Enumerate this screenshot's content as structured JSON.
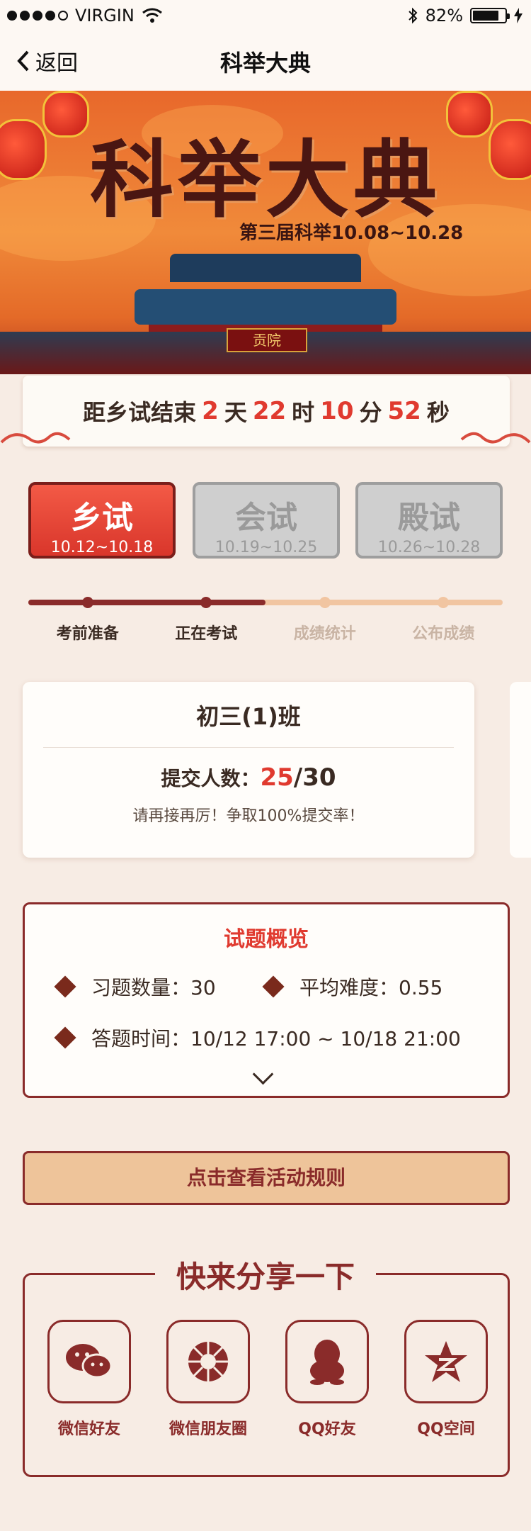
{
  "status_bar": {
    "carrier": "VIRGIN",
    "battery": "82%",
    "battery_level": 0.82
  },
  "nav": {
    "back_label": "返回",
    "title": "科举大典"
  },
  "banner": {
    "title": "科举大典",
    "subtitle": "第三届科举10.08~10.28",
    "plaque": "贡院"
  },
  "countdown": {
    "prefix": "距乡试结束",
    "days": "2",
    "days_unit": "天",
    "hours": "22",
    "hours_unit": "时",
    "minutes": "10",
    "minutes_unit": "分",
    "seconds": "52",
    "seconds_unit": "秒"
  },
  "stages": [
    {
      "name": "乡试",
      "dates": "10.12~10.18"
    },
    {
      "name": "会试",
      "dates": "10.19~10.25"
    },
    {
      "name": "殿试",
      "dates": "10.26~10.28"
    }
  ],
  "progress": {
    "steps": [
      "考前准备",
      "正在考试",
      "成绩统计",
      "公布成绩"
    ],
    "current_step": 2
  },
  "class_card": {
    "class_name": "初三(1)班",
    "submit_label": "提交人数：",
    "submitted": "25",
    "total": "/30",
    "encourage": "请再接再厉！争取100%提交率！"
  },
  "overview": {
    "title": "试题概览",
    "count_label": "习题数量：30",
    "difficulty_label": "平均难度：0.55",
    "time_label": "答题时间：10/12 17:00 ~ 10/18 21:00"
  },
  "rules_button": "点击查看活动规则",
  "share": {
    "title": "快来分享一下",
    "items": [
      "微信好友",
      "微信朋友圈",
      "QQ好友",
      "QQ空间"
    ]
  },
  "colors": {
    "accent_red": "#e03a2f",
    "dark_red": "#8a2b2a",
    "background": "#f7ece4"
  }
}
